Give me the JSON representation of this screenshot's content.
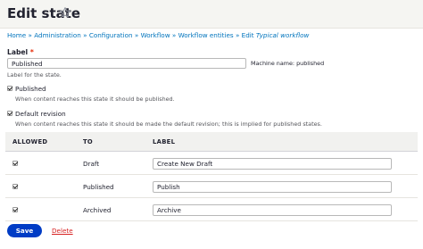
{
  "header": {
    "title": "Edit state",
    "star_icon": "star-outline-icon"
  },
  "breadcrumb": {
    "items": [
      "Home",
      "Administration",
      "Configuration",
      "Workflow",
      "Workflow entities"
    ],
    "separator": "»",
    "current_prefix": "Edit",
    "current_emphasis": "Typical workflow"
  },
  "label_field": {
    "label": "Label",
    "required_mark": "*",
    "value": "Published",
    "machine_name": "Machine name: published",
    "description": "Label for the state."
  },
  "published_option": {
    "checked": true,
    "label": "Published",
    "description": "When content reaches this state it should be published."
  },
  "default_revision_option": {
    "checked": true,
    "label": "Default revision",
    "description": "When content reaches this state it should be made the default revision; this is implied for published states."
  },
  "transitions_table": {
    "headers": {
      "allowed": "ALLOWED",
      "to": "TO",
      "label": "LABEL"
    },
    "rows": [
      {
        "allowed": true,
        "to": "Draft",
        "label": "Create New Draft"
      },
      {
        "allowed": true,
        "to": "Published",
        "label": "Publish"
      },
      {
        "allowed": true,
        "to": "Archived",
        "label": "Archive"
      }
    ]
  },
  "actions": {
    "save_label": "Save",
    "delete_label": "Delete"
  },
  "colors": {
    "link": "#0074bd",
    "primary_button": "#003cc5",
    "danger": "#d72222",
    "required": "#e62600"
  }
}
